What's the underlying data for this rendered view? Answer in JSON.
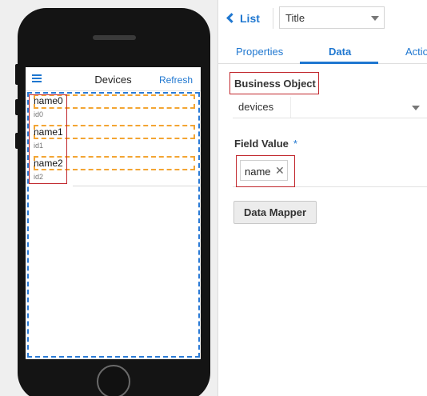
{
  "phone_screen": {
    "title": "Devices",
    "refresh_label": "Refresh",
    "hamburger_icon": "hamburger-menu-icon",
    "accent": "#1f77d0",
    "items": [
      {
        "name": "name0",
        "id": "id0"
      },
      {
        "name": "name1",
        "id": "id1"
      },
      {
        "name": "name2",
        "id": "id2"
      }
    ]
  },
  "panel": {
    "back_label": "List",
    "back_icon": "chevron-left-icon",
    "title_select_value": "Title",
    "tabs": [
      {
        "label": "Properties"
      },
      {
        "label": "Data"
      },
      {
        "label": "Actio"
      }
    ],
    "active_tab": "Data",
    "business_object": {
      "label": "Business Object",
      "value": "devices"
    },
    "field_value": {
      "label": "Field Value",
      "required_mark": "*",
      "chip": "name",
      "chip_remove": "✕"
    },
    "data_mapper_label": "Data Mapper",
    "highlight_color": "#c1272d"
  }
}
